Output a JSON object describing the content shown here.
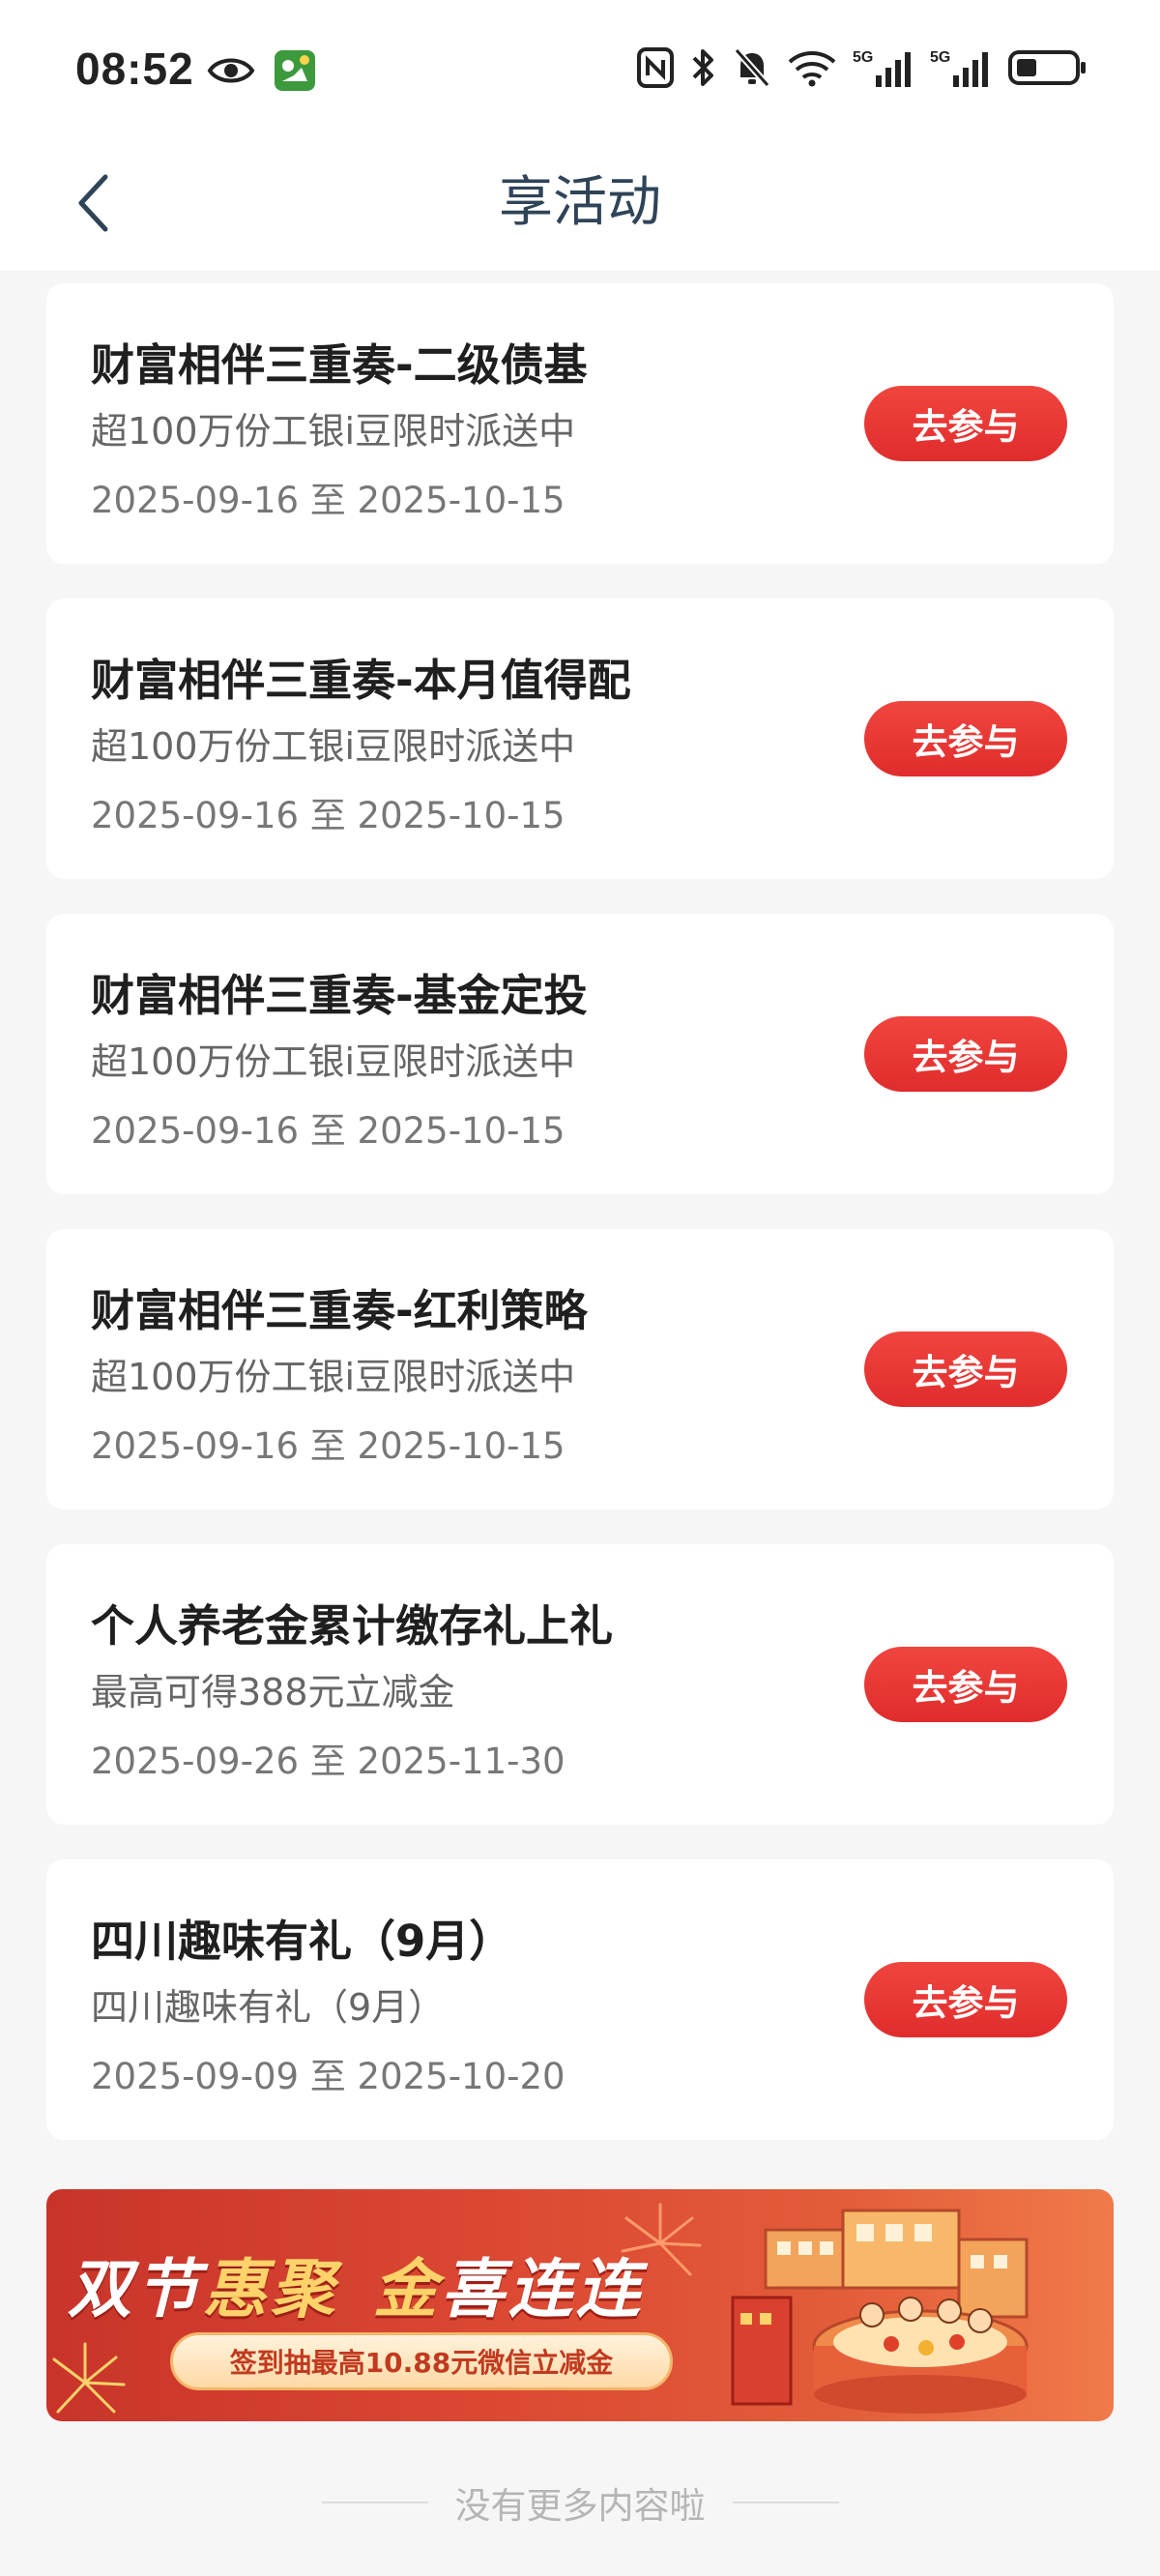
{
  "status_bar": {
    "time": "08:52",
    "left_icons": [
      "eye-icon",
      "app-notification-icon"
    ],
    "right_icons": [
      "nfc-icon",
      "bluetooth-icon",
      "bell-off-icon",
      "wifi-icon",
      "signal-5g-icon",
      "signal-5g-icon",
      "battery-icon"
    ],
    "network_label_1": "5G",
    "network_label_2": "5G"
  },
  "header": {
    "title": "享活动",
    "back_icon": "chevron-left-icon"
  },
  "activities": [
    {
      "title": "财富相伴三重奏-二级债基",
      "subtitle": "超100万份工银i豆限时派送中",
      "date": "2025-09-16 至 2025-10-15",
      "button_label": "去参与"
    },
    {
      "title": "财富相伴三重奏-本月值得配",
      "subtitle": "超100万份工银i豆限时派送中",
      "date": "2025-09-16 至 2025-10-15",
      "button_label": "去参与"
    },
    {
      "title": "财富相伴三重奏-基金定投",
      "subtitle": "超100万份工银i豆限时派送中",
      "date": "2025-09-16 至 2025-10-15",
      "button_label": "去参与"
    },
    {
      "title": "财富相伴三重奏-红利策略",
      "subtitle": "超100万份工银i豆限时派送中",
      "date": "2025-09-16 至 2025-10-15",
      "button_label": "去参与"
    },
    {
      "title": "个人养老金累计缴存礼上礼",
      "subtitle": "最高可得388元立减金",
      "date": "2025-09-26 至 2025-11-30",
      "button_label": "去参与"
    },
    {
      "title": "四川趣味有礼（9月）",
      "subtitle": "四川趣味有礼（9月）",
      "date": "2025-09-09 至 2025-10-20",
      "button_label": "去参与"
    }
  ],
  "banner": {
    "title_part1": "双节",
    "title_part2": "惠聚",
    "title_part3": "金",
    "title_part4": "喜连连",
    "subtitle": "签到抽最高10.88元微信立减金"
  },
  "footer": {
    "end_text": "没有更多内容啦"
  },
  "colors": {
    "accent_red": "#e02c2c",
    "title_blue": "#2f4458",
    "page_bg": "#f6f6f7"
  }
}
